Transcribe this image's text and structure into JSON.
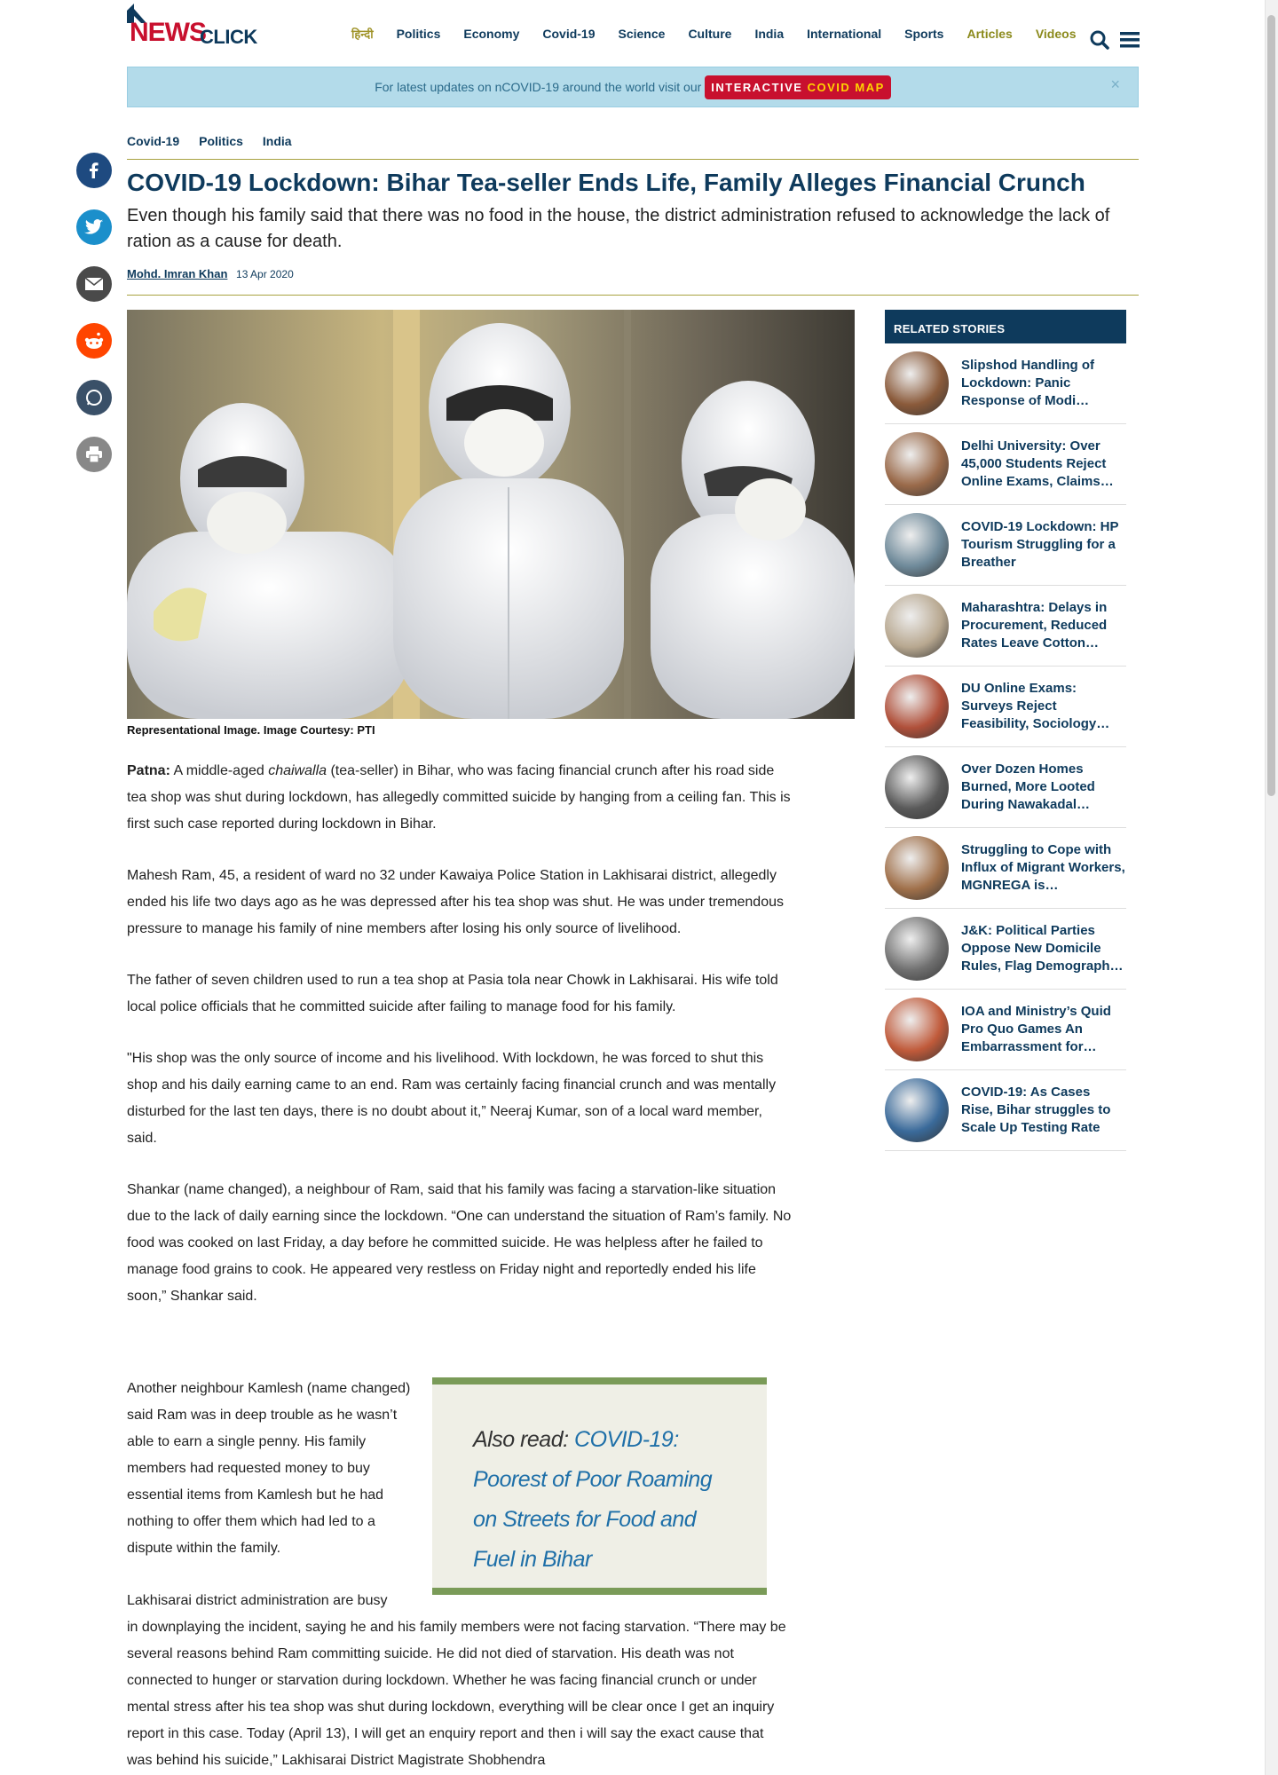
{
  "header": {
    "logo_news": "NEWS",
    "logo_click": "CLICK",
    "nav": [
      {
        "label": "हिन्दी",
        "style": "hindi"
      },
      {
        "label": "Politics",
        "style": ""
      },
      {
        "label": "Economy",
        "style": ""
      },
      {
        "label": "Covid-19",
        "style": ""
      },
      {
        "label": "Science",
        "style": ""
      },
      {
        "label": "Culture",
        "style": ""
      },
      {
        "label": "India",
        "style": ""
      },
      {
        "label": "International",
        "style": ""
      },
      {
        "label": "Sports",
        "style": ""
      },
      {
        "label": "Articles",
        "style": "olive"
      },
      {
        "label": "Videos",
        "style": "olive"
      }
    ]
  },
  "banner": {
    "text": "For latest updates on nCOVID-19 around the world visit our",
    "button_part1": "INTERACTIVE ",
    "button_part2": "COVID MAP",
    "close": "×"
  },
  "social": [
    "facebook-icon",
    "twitter-icon",
    "email-icon",
    "reddit-icon",
    "whatsapp-icon",
    "print-icon"
  ],
  "article": {
    "crumbs": [
      "Covid-19",
      "Politics",
      "India"
    ],
    "title": "COVID-19 Lockdown: Bihar Tea-seller Ends Life, Family Alleges Financial Crunch",
    "subtitle": "Even though his family said that there was no food in the house, the district administration refused to acknowledge the lack of ration as a cause for death.",
    "author": "Mohd. Imran Khan",
    "date": "13 Apr 2020",
    "caption": "Representational Image. Image Courtesy: PTI",
    "p1_lead": "Patna:",
    "p1_a": " A middle-aged ",
    "p1_italic": "chaiwalla",
    "p1_b": " (tea-seller) in Bihar, who was facing financial crunch after his road side tea shop was shut during lockdown, has allegedly committed suicide by hanging from a ceiling fan. This is first such case reported during lockdown in Bihar.",
    "p2": "Mahesh Ram, 45, a resident of ward no 32 under Kawaiya Police Station in Lakhisarai district, allegedly ended his life two days ago as he was depressed after his tea shop was shut. He was under tremendous pressure to manage his family of nine members after losing his only source of livelihood.",
    "p3": "The father of seven children used to run a tea shop at Pasia tola near Chowk in Lakhisarai. His wife told local police officials that he committed suicide after failing to manage food for his family.",
    "p4": "\"His shop was the only source of income and his livelihood. With lockdown, he was forced to shut this shop and his daily earning came to an end. Ram was certainly facing financial crunch and was mentally disturbed for the last ten days, there is no doubt about it,” Neeraj Kumar, son of a local ward member, said.",
    "p5": "Shankar (name changed), a neighbour of Ram, said that his family was facing a starvation-like situation due to the lack of daily earning since the lockdown. “One can understand the situation of Ram’s family. No food was cooked on last Friday, a day before he committed suicide. He was helpless after he failed to manage food grains to cook. He appeared very restless on Friday night and reportedly ended his life soon,” Shankar said.",
    "p6": "Another neighbour Kamlesh (name changed) said Ram was in deep trouble as he wasn’t able to earn a single penny. His family members had requested money to buy essential items from Kamlesh but he had nothing to offer them which had led to a dispute within the family.",
    "p7_first": "Lakhisarai district administration are busy",
    "p7_rest": "in downplaying the incident, saying he and his family members were not facing starvation. “There may be several reasons behind Ram committing suicide. He did not died of starvation. His death was not connected to hunger or starvation during lockdown. Whether he was facing financial crunch or under mental stress after his tea shop was shut during lockdown, everything will be clear once I get an inquiry report in this case. Today (April 13), I will get an enquiry report and then i will say the exact cause that was behind his suicide,” Lakhisarai District Magistrate Shobhendra",
    "also_read_label": "Also read: ",
    "also_read_link": "COVID-19: Poorest of Poor Roaming on Streets for Food and Fuel in Bihar"
  },
  "related": {
    "heading": "RELATED STORIES",
    "items": [
      {
        "title": "Slipshod Handling of Lockdown: Panic Response of Modi…",
        "color": "#8a5a3a"
      },
      {
        "title": "Delhi University: Over 45,000 Students Reject Online Exams, Claims…",
        "color": "#9a6a4a"
      },
      {
        "title": "COVID-19 Lockdown: HP Tourism Struggling for a Breather",
        "color": "#6f8a9a"
      },
      {
        "title": "Maharashtra: Delays in Procurement, Reduced Rates Leave Cotton…",
        "color": "#b8a890"
      },
      {
        "title": "DU Online Exams: Surveys Reject Feasibility, Sociology…",
        "color": "#b0503a"
      },
      {
        "title": "Over Dozen Homes Burned, More Looted During Nawakadal…",
        "color": "#5a5a5a"
      },
      {
        "title": "Struggling to Cope with Influx of Migrant Workers, MGNREGA is…",
        "color": "#a0704a"
      },
      {
        "title": "J&K: Political Parties Oppose New Domicile Rules, Flag Demograph…",
        "color": "#707070"
      },
      {
        "title": "IOA and Ministry’s Quid Pro Quo Games An Embarrassment for…",
        "color": "#c05a3a"
      },
      {
        "title": "COVID-19: As Cases Rise, Bihar struggles to Scale Up Testing Rate",
        "color": "#3a6a9a"
      }
    ]
  }
}
